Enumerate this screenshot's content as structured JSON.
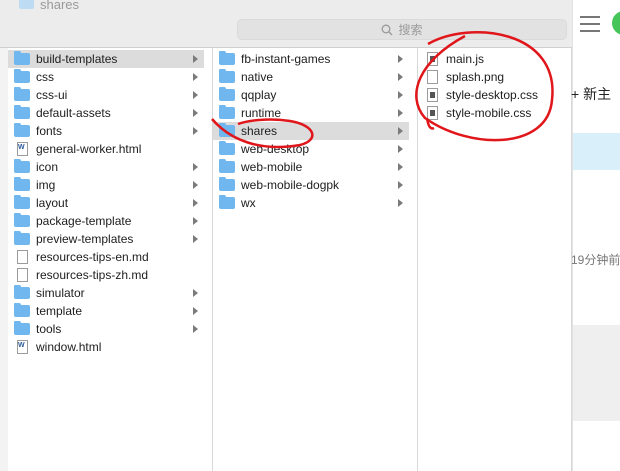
{
  "window": {
    "title": "shares"
  },
  "search": {
    "placeholder": "搜索"
  },
  "column1": {
    "items": [
      {
        "label": "build-templates",
        "type": "folder",
        "arrow": true,
        "selected": true
      },
      {
        "label": "css",
        "type": "folder",
        "arrow": true
      },
      {
        "label": "css-ui",
        "type": "folder",
        "arrow": true
      },
      {
        "label": "default-assets",
        "type": "folder",
        "arrow": true
      },
      {
        "label": "fonts",
        "type": "folder",
        "arrow": true
      },
      {
        "label": "general-worker.html",
        "type": "word"
      },
      {
        "label": "icon",
        "type": "folder",
        "arrow": true
      },
      {
        "label": "img",
        "type": "folder",
        "arrow": true
      },
      {
        "label": "layout",
        "type": "folder",
        "arrow": true
      },
      {
        "label": "package-template",
        "type": "folder",
        "arrow": true
      },
      {
        "label": "preview-templates",
        "type": "folder",
        "arrow": true
      },
      {
        "label": "resources-tips-en.md",
        "type": "file"
      },
      {
        "label": "resources-tips-zh.md",
        "type": "file"
      },
      {
        "label": "simulator",
        "type": "folder",
        "arrow": true
      },
      {
        "label": "template",
        "type": "folder",
        "arrow": true
      },
      {
        "label": "tools",
        "type": "folder",
        "arrow": true
      },
      {
        "label": "window.html",
        "type": "word"
      }
    ]
  },
  "column2": {
    "items": [
      {
        "label": "fb-instant-games",
        "type": "folder",
        "arrow": true
      },
      {
        "label": "native",
        "type": "folder",
        "arrow": true
      },
      {
        "label": "qqplay",
        "type": "folder",
        "arrow": true
      },
      {
        "label": "runtime",
        "type": "folder",
        "arrow": true
      },
      {
        "label": "shares",
        "type": "folder",
        "arrow": true,
        "selected": true
      },
      {
        "label": "web-desktop",
        "type": "folder",
        "arrow": true
      },
      {
        "label": "web-mobile",
        "type": "folder",
        "arrow": true
      },
      {
        "label": "web-mobile-dogpk",
        "type": "folder",
        "arrow": true
      },
      {
        "label": "wx",
        "type": "folder",
        "arrow": true
      }
    ]
  },
  "column3": {
    "items": [
      {
        "label": "main.js",
        "type": "doc"
      },
      {
        "label": "splash.png",
        "type": "file"
      },
      {
        "label": "style-desktop.css",
        "type": "doc"
      },
      {
        "label": "style-mobile.css",
        "type": "doc"
      }
    ]
  },
  "right_app": {
    "new_topic": "+ 新主",
    "time_ago": "19分钟前"
  },
  "colors": {
    "annotation": "#e0161b",
    "folder": "#6fb7ee",
    "selection": "#dcdcdc"
  }
}
